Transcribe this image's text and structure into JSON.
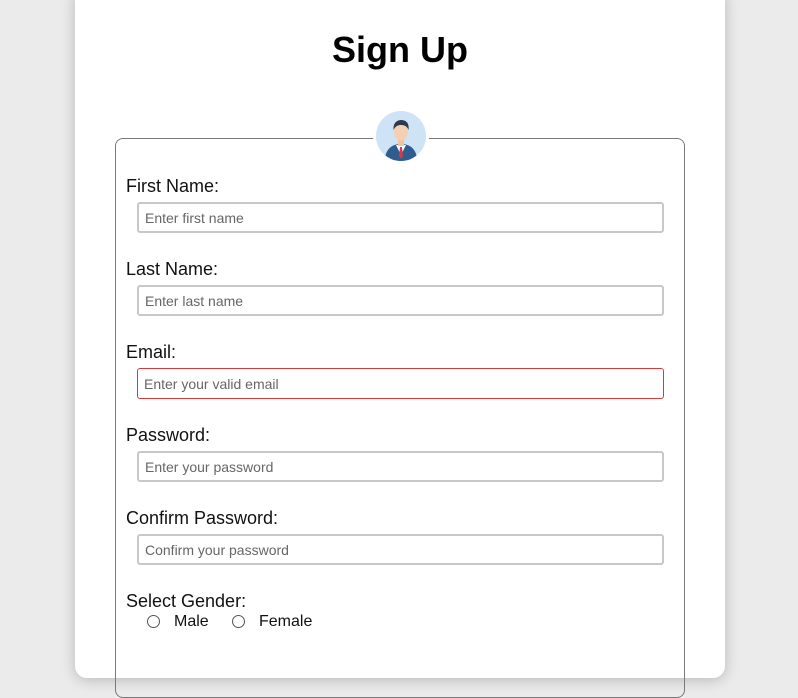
{
  "form": {
    "title": "Sign Up",
    "avatar_icon": "user-avatar-icon",
    "fields": {
      "first_name": {
        "label": "First Name:",
        "placeholder": "Enter first name",
        "value": ""
      },
      "last_name": {
        "label": "Last Name:",
        "placeholder": "Enter last name",
        "value": ""
      },
      "email": {
        "label": "Email:",
        "placeholder": "Enter your valid email",
        "value": ""
      },
      "password": {
        "label": "Password:",
        "placeholder": "Enter your password",
        "value": ""
      },
      "confirm_password": {
        "label": "Confirm Password:",
        "placeholder": "Confirm your password",
        "value": ""
      }
    },
    "gender": {
      "label": "Select Gender:",
      "options": [
        "Male",
        "Female"
      ]
    }
  },
  "colors": {
    "page_background": "#ebebeb",
    "card_background": "#ffffff",
    "invalid_border": "#d23b3b",
    "input_border": "#c8c8c8"
  }
}
